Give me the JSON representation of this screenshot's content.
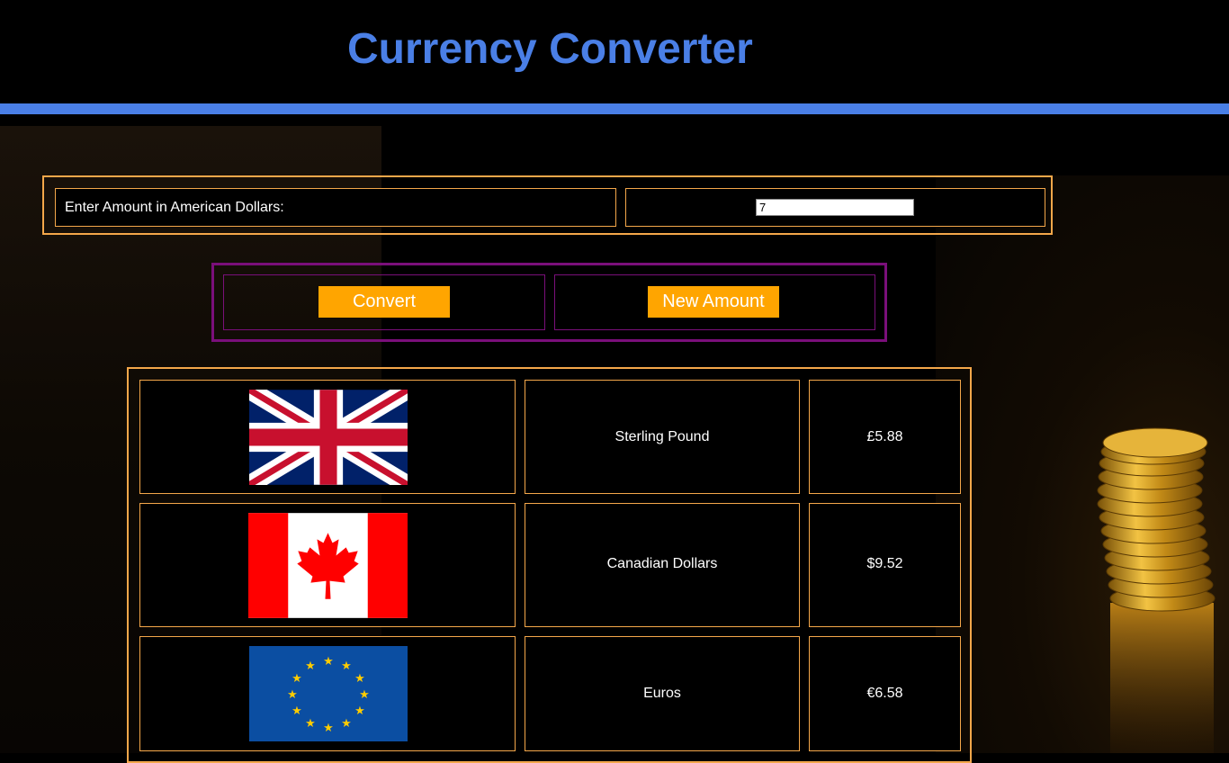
{
  "header": {
    "title": "Currency Converter"
  },
  "amount": {
    "label": "Enter Amount in American Dollars:",
    "value": "7"
  },
  "buttons": {
    "convert": "Convert",
    "new_amount": "New Amount"
  },
  "currencies": [
    {
      "flag_icon": "uk-flag-icon",
      "name": "Sterling Pound",
      "value": "£5.88"
    },
    {
      "flag_icon": "canada-flag-icon",
      "name": "Canadian Dollars",
      "value": "$9.52"
    },
    {
      "flag_icon": "eu-flag-icon",
      "name": "Euros",
      "value": "€6.58"
    }
  ],
  "colors": {
    "title": "#4a7fe6",
    "accent_border": "#f4a74a",
    "button_box_border": "#7a0f7a",
    "button": "#ffa500"
  }
}
